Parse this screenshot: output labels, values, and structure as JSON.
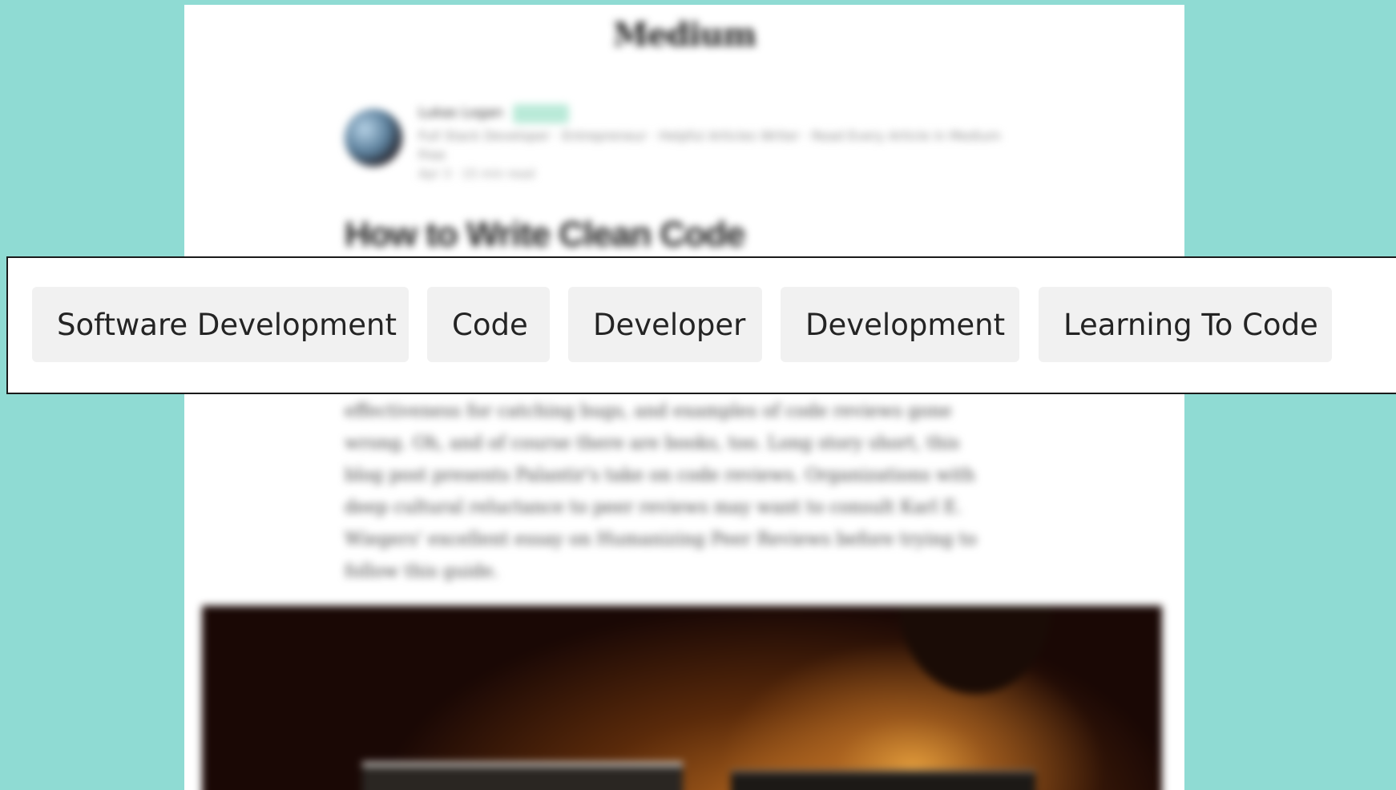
{
  "site": {
    "title": "Medium"
  },
  "author": {
    "name": "Lukas Logan",
    "bio": "Full Stack Developer · Entrepreneur · Helpful Articles Writer · Read Every Article in Medium Free",
    "meta": "Apr 3 · 15 min read"
  },
  "article": {
    "title": "How to Write Clean Code",
    "body": "effectiveness for catching bugs, and examples of code reviews gone wrong. Oh, and of course there are books, too. Long story short, this blog post presents Palantir's take on code reviews. Organizations with deep cultural reluctance to peer reviews may want to consult Karl E. Wiegers' excellent essay on Humanizing Peer Reviews before trying to follow this guide."
  },
  "tags": [
    "Software Development",
    "Code",
    "Developer",
    "Development",
    "Learning To Code"
  ]
}
